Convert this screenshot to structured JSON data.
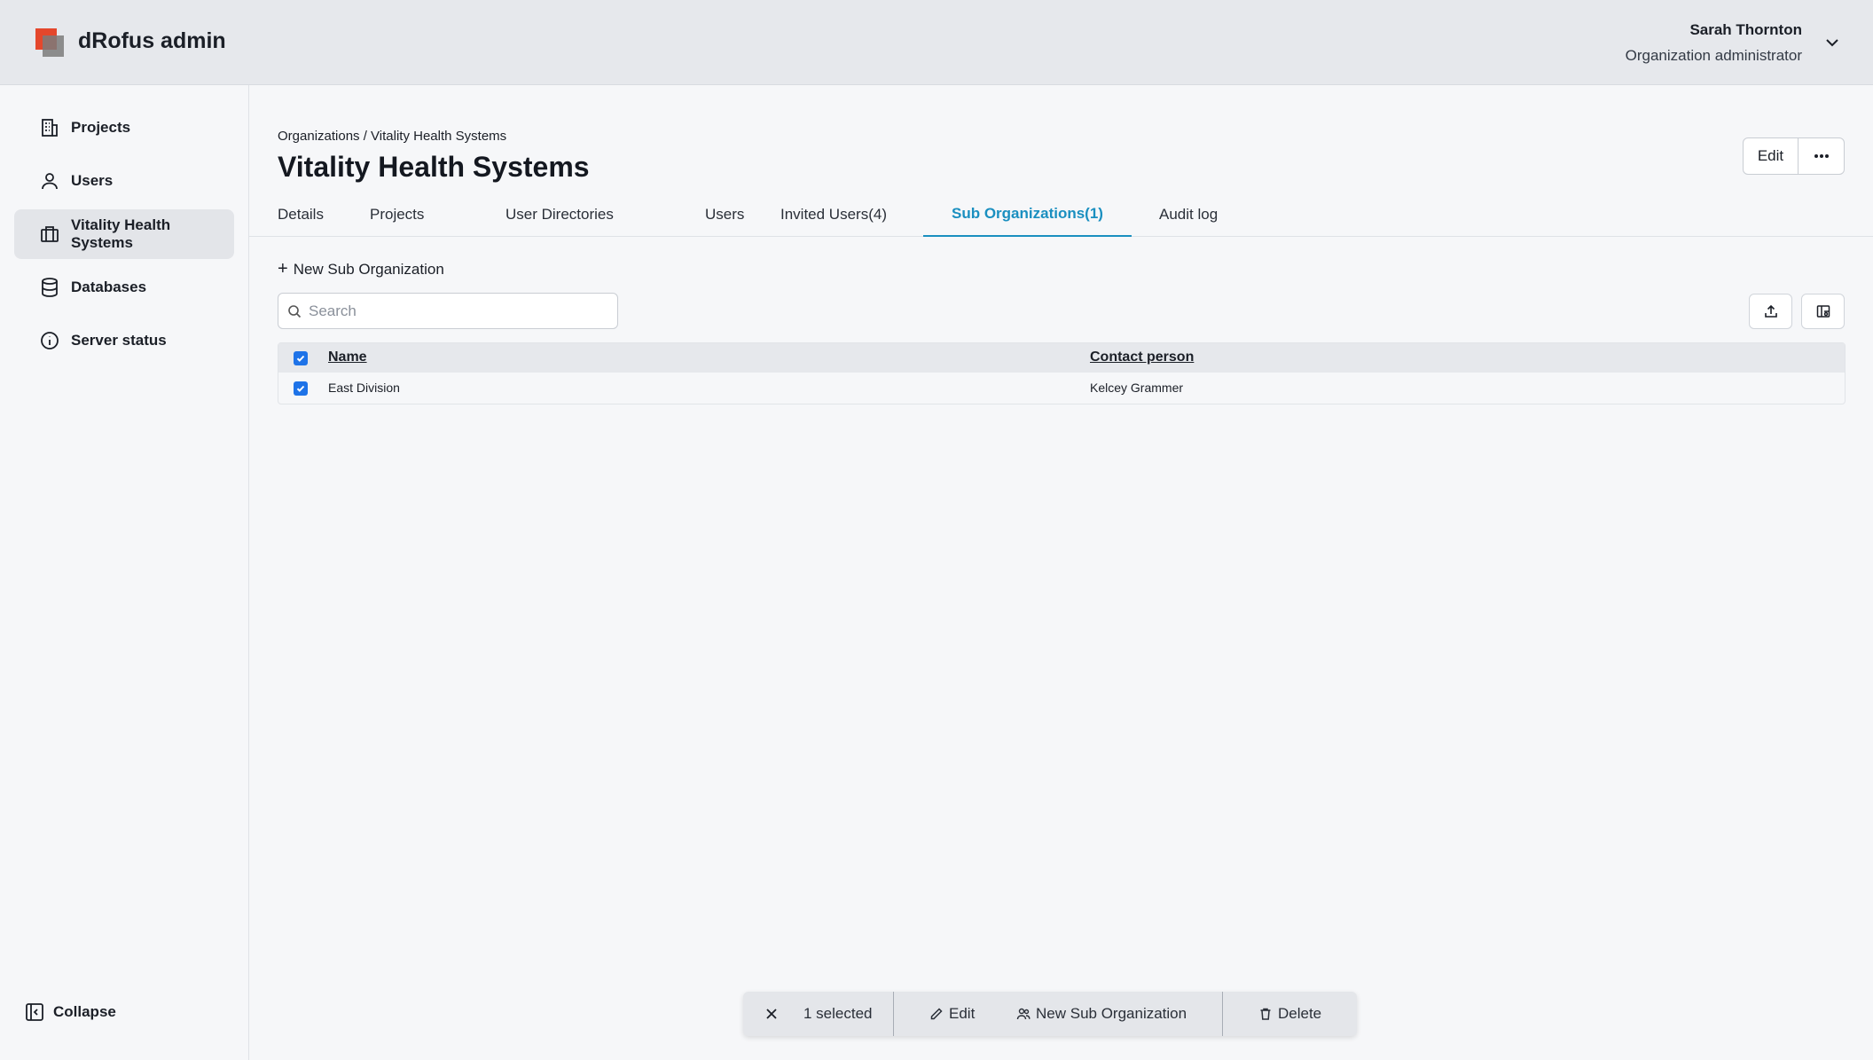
{
  "app": {
    "title": "dRofus admin"
  },
  "user": {
    "name": "Sarah Thornton",
    "role": "Organization administrator"
  },
  "sidebar": {
    "items": [
      {
        "label": "Projects",
        "icon": "building-icon"
      },
      {
        "label": "Users",
        "icon": "user-icon"
      },
      {
        "label": "Vitality Health Systems",
        "icon": "briefcase-icon",
        "active": true
      },
      {
        "label": "Databases",
        "icon": "database-icon"
      },
      {
        "label": "Server status",
        "icon": "info-icon"
      }
    ],
    "collapse_label": "Collapse"
  },
  "page": {
    "breadcrumb": "Organizations / Vitality Health Systems",
    "title": "Vitality Health Systems",
    "edit_label": "Edit"
  },
  "tabs": [
    {
      "label": "Details"
    },
    {
      "label": "Projects"
    },
    {
      "label": "User Directories"
    },
    {
      "label": "Users"
    },
    {
      "label": "Invited Users(4)"
    },
    {
      "label": "Sub Organizations(1)",
      "active": true
    },
    {
      "label": "Audit log"
    }
  ],
  "toolbar": {
    "new_sub_label": "New Sub Organization",
    "search_placeholder": "Search"
  },
  "table": {
    "columns": [
      "Name",
      "Contact person"
    ],
    "rows": [
      {
        "name": "East Division",
        "contact": "Kelcey Grammer",
        "checked": true
      }
    ]
  },
  "actionbar": {
    "selected_label": "1 selected",
    "edit_label": "Edit",
    "new_sub_label": "New Sub Organization",
    "delete_label": "Delete"
  },
  "colors": {
    "accent": "#1a8fc0",
    "checkbox": "#1e73e8",
    "brand": "#e4472c"
  }
}
